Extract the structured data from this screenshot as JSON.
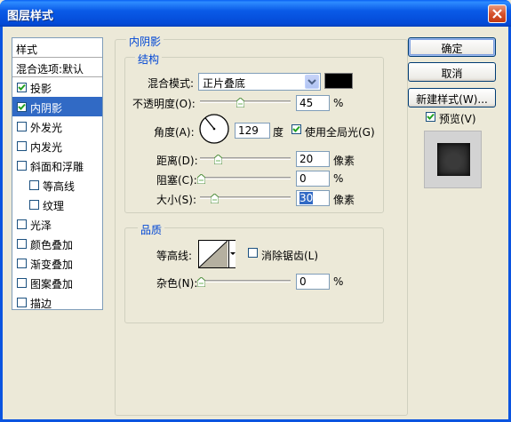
{
  "window": {
    "title": "图层样式",
    "close_icon": "close-icon"
  },
  "style_list": {
    "header": "样式",
    "blend": "混合选项:默认",
    "items": [
      {
        "label": "投影",
        "checked": true,
        "selected": false,
        "indent": false
      },
      {
        "label": "内阴影",
        "checked": true,
        "selected": true,
        "indent": false
      },
      {
        "label": "外发光",
        "checked": false,
        "selected": false,
        "indent": false
      },
      {
        "label": "内发光",
        "checked": false,
        "selected": false,
        "indent": false
      },
      {
        "label": "斜面和浮雕",
        "checked": false,
        "selected": false,
        "indent": false
      },
      {
        "label": "等高线",
        "checked": false,
        "selected": false,
        "indent": true
      },
      {
        "label": "纹理",
        "checked": false,
        "selected": false,
        "indent": true
      },
      {
        "label": "光泽",
        "checked": false,
        "selected": false,
        "indent": false
      },
      {
        "label": "颜色叠加",
        "checked": false,
        "selected": false,
        "indent": false
      },
      {
        "label": "渐变叠加",
        "checked": false,
        "selected": false,
        "indent": false
      },
      {
        "label": "图案叠加",
        "checked": false,
        "selected": false,
        "indent": false
      },
      {
        "label": "描边",
        "checked": false,
        "selected": false,
        "indent": false
      }
    ]
  },
  "inner_shadow": {
    "group_title": "内阴影",
    "structure": {
      "title": "结构",
      "blend_mode_label": "混合模式:",
      "blend_mode_value": "正片叠底",
      "color": "#000000",
      "opacity_label": "不透明度(O):",
      "opacity_value": "45",
      "opacity_unit": "%",
      "angle_label": "角度(A):",
      "angle_value": "129",
      "angle_unit": "度",
      "global_light_label": "使用全局光(G)",
      "global_light_checked": true,
      "distance_label": "距离(D):",
      "distance_value": "20",
      "distance_unit": "像素",
      "choke_label": "阻塞(C):",
      "choke_value": "0",
      "choke_unit": "%",
      "size_label": "大小(S):",
      "size_value": "30",
      "size_unit": "像素"
    },
    "quality": {
      "title": "品质",
      "contour_label": "等高线:",
      "antialias_label": "消除锯齿(L)",
      "antialias_checked": false,
      "noise_label": "杂色(N):",
      "noise_value": "0",
      "noise_unit": "%"
    }
  },
  "buttons": {
    "ok": "确定",
    "cancel": "取消",
    "new_style": "新建样式(W)...",
    "preview_label": "预览(V)",
    "preview_checked": true
  }
}
